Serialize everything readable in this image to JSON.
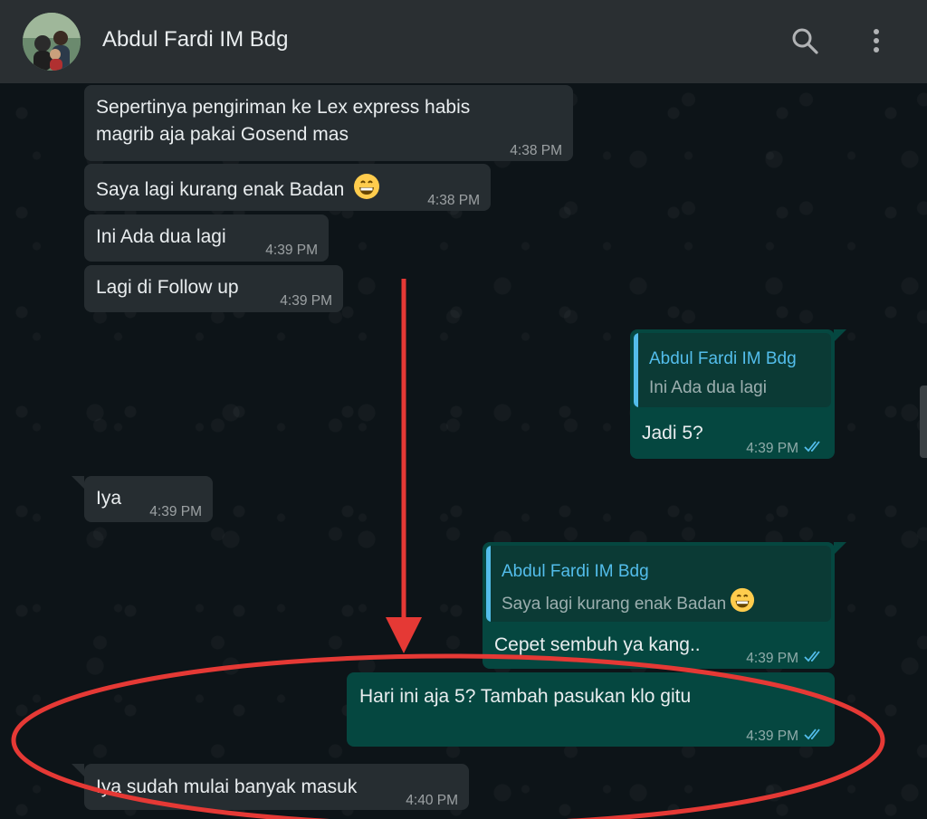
{
  "header": {
    "contact_name": "Abdul Fardi IM Bdg",
    "avatar_icon": "group-photo-avatar",
    "search_icon": "search-icon",
    "menu_icon": "more-vertical-icon"
  },
  "colors": {
    "header_bg": "#2a2f32",
    "chat_bg": "#0d1418",
    "incoming_bubble": "#262d31",
    "outgoing_bubble": "#054740",
    "quote_accent": "#53bdeb",
    "read_ticks": "#53bdeb",
    "annotation_red": "#e53935"
  },
  "messages": [
    {
      "id": "m1",
      "direction": "incoming",
      "line1": "Sepertinya pengiriman ke Lex express habis",
      "line2": "magrib aja pakai Gosend mas",
      "time": "4:38 PM"
    },
    {
      "id": "m2",
      "direction": "incoming",
      "text": "Saya lagi kurang enak Badan",
      "emoji": "grinning-face",
      "time": "4:38 PM"
    },
    {
      "id": "m3",
      "direction": "incoming",
      "text": "Ini Ada dua lagi",
      "time": "4:39 PM"
    },
    {
      "id": "m4",
      "direction": "incoming",
      "text": "Lagi di Follow up",
      "time": "4:39 PM"
    },
    {
      "id": "m5",
      "direction": "outgoing",
      "quote_author": "Abdul Fardi IM Bdg",
      "quote_text": "Ini Ada dua lagi",
      "text": "Jadi 5?",
      "time": "4:39 PM",
      "status": "read"
    },
    {
      "id": "m6",
      "direction": "incoming",
      "text": "Iya",
      "time": "4:39 PM"
    },
    {
      "id": "m7",
      "direction": "outgoing",
      "quote_author": "Abdul Fardi IM Bdg",
      "quote_text": "Saya lagi kurang enak Badan",
      "quote_emoji": "grinning-face",
      "text": "Cepet sembuh ya kang..",
      "time": "4:39 PM",
      "status": "read"
    },
    {
      "id": "m8",
      "direction": "outgoing",
      "text": "Hari ini aja 5? Tambah pasukan klo gitu",
      "time": "4:39 PM",
      "status": "read"
    },
    {
      "id": "m9",
      "direction": "incoming",
      "text": "Iya sudah mulai banyak masuk",
      "time": "4:40 PM"
    }
  ],
  "annotations": {
    "arrow": "red-down-arrow",
    "ellipse": "red-highlight-ellipse"
  }
}
